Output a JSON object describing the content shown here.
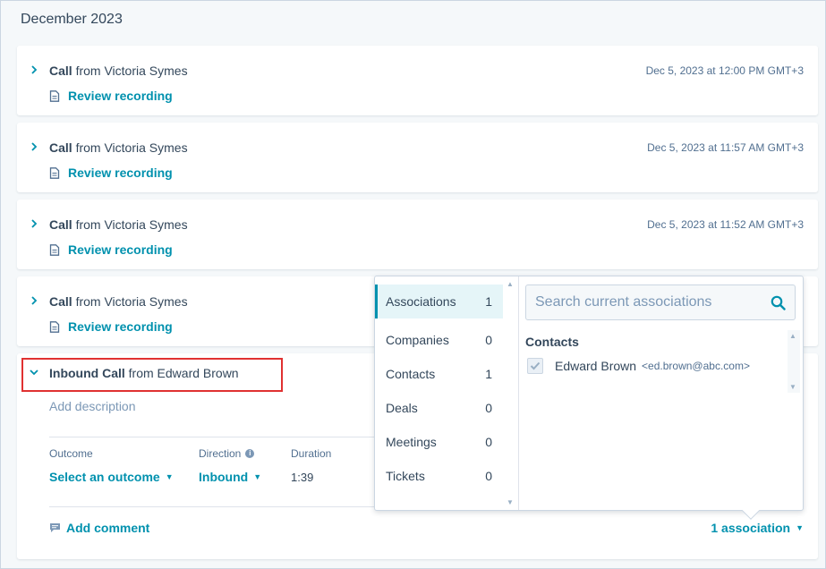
{
  "timeline": {
    "month_heading": "December 2023",
    "calls": [
      {
        "type": "Call",
        "from_text": "from Victoria Symes",
        "timestamp": "Dec 5, 2023 at 12:00 PM GMT+3",
        "action": "Review recording"
      },
      {
        "type": "Call",
        "from_text": "from Victoria Symes",
        "timestamp": "Dec 5, 2023 at 11:57 AM GMT+3",
        "action": "Review recording"
      },
      {
        "type": "Call",
        "from_text": "from Victoria Symes",
        "timestamp": "Dec 5, 2023 at 11:52 AM GMT+3",
        "action": "Review recording"
      },
      {
        "type": "Call",
        "from_text": "from Victoria Symes",
        "timestamp": "",
        "action": "Review recording"
      }
    ],
    "expanded_call": {
      "type": "Inbound Call",
      "from_text": "from Edward Brown",
      "description_placeholder": "Add description",
      "outcome_label": "Outcome",
      "outcome_value": "Select an outcome",
      "direction_label": "Direction",
      "direction_value": "Inbound",
      "duration_label": "Duration",
      "duration_value": "1:39",
      "comment_action": "Add comment",
      "association_link": "1 association"
    }
  },
  "associations_popover": {
    "categories": [
      {
        "label": "Associations",
        "count": "1",
        "active": true
      },
      {
        "label": "Companies",
        "count": "0"
      },
      {
        "label": "Contacts",
        "count": "1"
      },
      {
        "label": "Deals",
        "count": "0"
      },
      {
        "label": "Meetings",
        "count": "0"
      },
      {
        "label": "Tickets",
        "count": "0"
      }
    ],
    "search_placeholder": "Search current associations",
    "section_heading": "Contacts",
    "contacts": [
      {
        "name": "Edward Brown",
        "email": "<ed.brown@abc.com>",
        "checked": true
      }
    ]
  },
  "colors": {
    "accent": "#0091ae",
    "text": "#33475b",
    "highlight_box": "#e03131"
  }
}
